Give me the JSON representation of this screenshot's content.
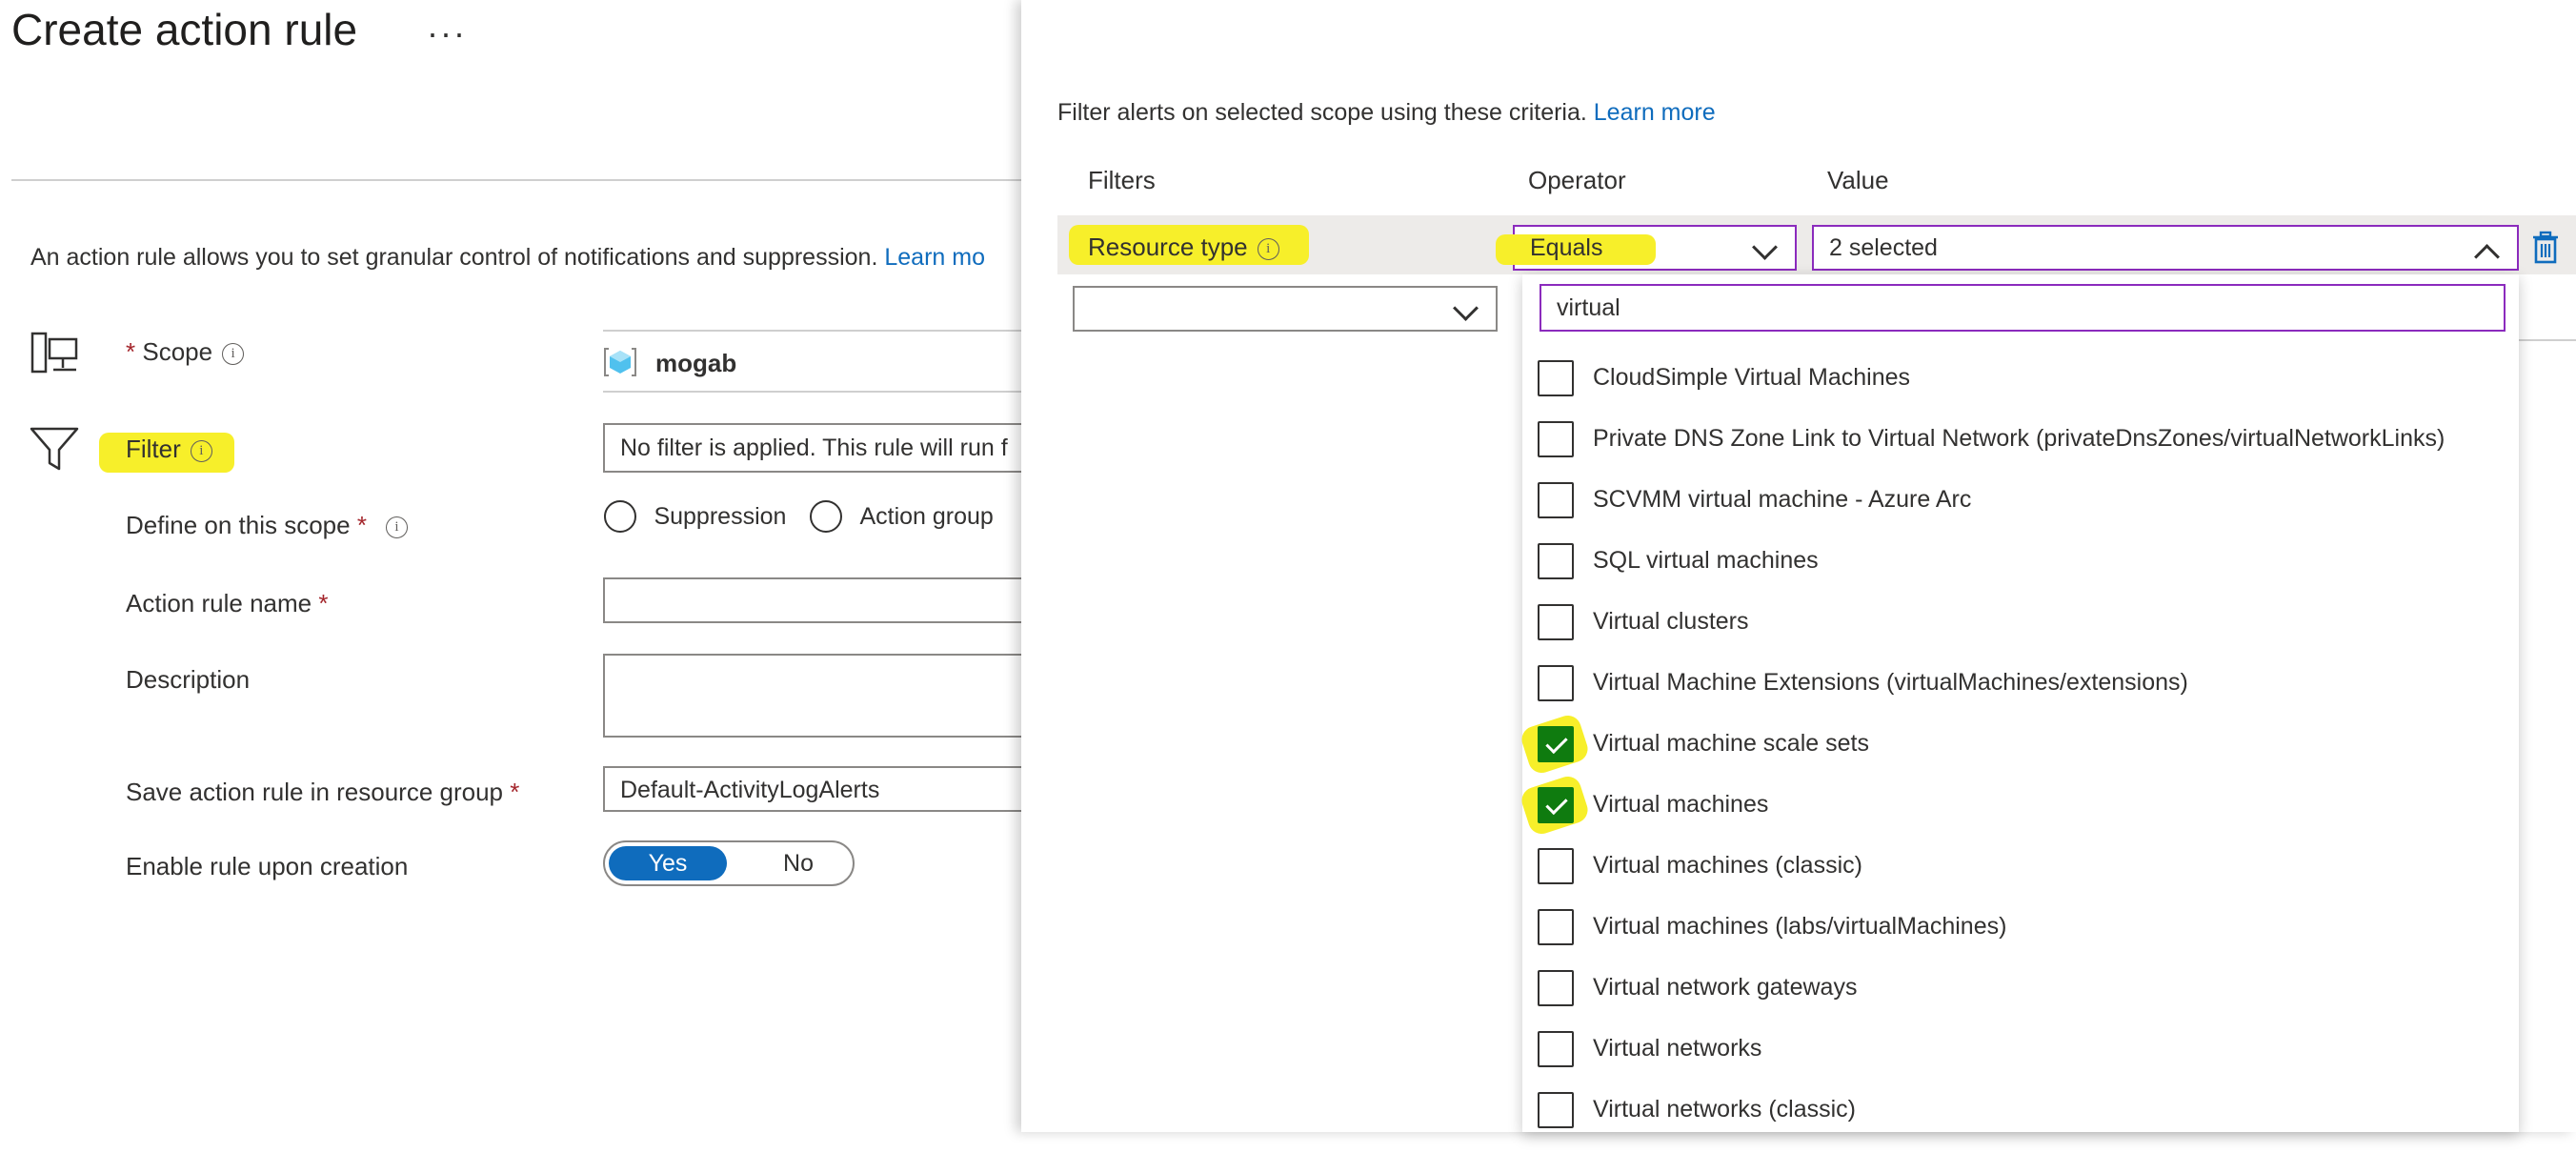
{
  "page": {
    "title": "Create action rule",
    "more_label": "···",
    "intro": "An action rule allows you to set granular control of notifications and suppression.",
    "intro_link": "Learn mo"
  },
  "form": {
    "scope": {
      "required_mark": "*",
      "label": "Scope",
      "value": "mogab"
    },
    "filter": {
      "label": "Filter",
      "value": "No filter is applied. This rule will run f"
    },
    "define_scope": {
      "label": "Define on this scope",
      "required_mark": "*",
      "options": [
        "Suppression",
        "Action group"
      ]
    },
    "action_rule_name": {
      "label": "Action rule name",
      "required_mark": "*",
      "value": ""
    },
    "description": {
      "label": "Description",
      "value": ""
    },
    "resource_group": {
      "label": "Save action rule in resource group",
      "required_mark": "*",
      "value": "Default-ActivityLogAlerts"
    },
    "enable_rule": {
      "label": "Enable rule upon creation",
      "yes": "Yes",
      "no": "No",
      "selected": "Yes"
    }
  },
  "panel": {
    "intro": "Filter alerts on selected scope using these criteria.",
    "intro_link": "Learn more",
    "headers": {
      "filters": "Filters",
      "operator": "Operator",
      "value": "Value"
    },
    "row": {
      "filter": "Resource type",
      "operator": "Equals",
      "value": "2 selected"
    },
    "search_value": "virtual",
    "options": [
      {
        "label": "CloudSimple Virtual Machines",
        "checked": false
      },
      {
        "label": "Private DNS Zone Link to Virtual Network (privateDnsZones/virtualNetworkLinks)",
        "checked": false
      },
      {
        "label": "SCVMM virtual machine - Azure Arc",
        "checked": false
      },
      {
        "label": "SQL virtual machines",
        "checked": false
      },
      {
        "label": "Virtual clusters",
        "checked": false
      },
      {
        "label": "Virtual Machine Extensions (virtualMachines/extensions)",
        "checked": false
      },
      {
        "label": "Virtual machine scale sets",
        "checked": true
      },
      {
        "label": "Virtual machines",
        "checked": true
      },
      {
        "label": "Virtual machines (classic)",
        "checked": false
      },
      {
        "label": "Virtual machines (labs/virtualMachines)",
        "checked": false
      },
      {
        "label": "Virtual network gateways",
        "checked": false
      },
      {
        "label": "Virtual networks",
        "checked": false
      },
      {
        "label": "Virtual networks (classic)",
        "checked": false
      }
    ]
  },
  "colors": {
    "accent": "#0f6cbd",
    "highlight": "#f7ef2a",
    "checked": "#0f7b0f",
    "focus_border": "#8b2bbd"
  }
}
